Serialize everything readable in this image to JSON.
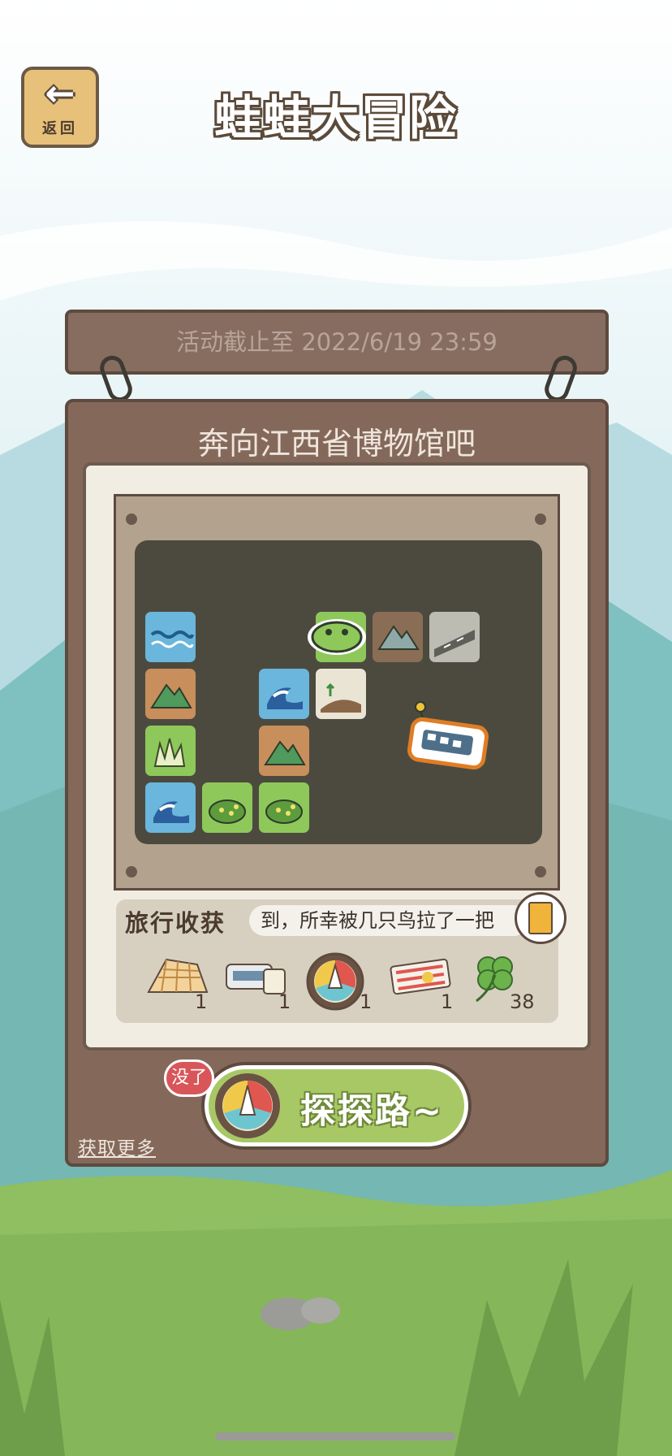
{
  "header": {
    "title": "蛙蛙大冒险",
    "back_label": "返回"
  },
  "event": {
    "deadline_text": "活动截止至 2022/6/19 23:59",
    "destination_title": "奔向江西省博物馆吧"
  },
  "map": {
    "tiles": [
      "water",
      "mountain",
      "grass",
      "wave",
      "bush",
      "bush",
      "wave",
      "mountain",
      "hill",
      "mountain-grey",
      "road"
    ],
    "markers": [
      "frog-icon",
      "train-ticket-marker"
    ]
  },
  "harvest": {
    "label": "旅行收获",
    "ticker": "到，所幸被几只鸟拉了一把",
    "items": [
      {
        "icon": "waffle-icon",
        "count": "1"
      },
      {
        "icon": "ticket-icon",
        "count": "1"
      },
      {
        "icon": "compass-icon",
        "count": "1"
      },
      {
        "icon": "sun-card-icon",
        "count": "1"
      },
      {
        "icon": "clover-icon",
        "count": "38"
      }
    ]
  },
  "actions": {
    "explore_label": "探探路~",
    "out_badge": "没了",
    "more_link": "获取更多"
  },
  "colors": {
    "wood": "#84695b",
    "accent_green": "#a8c866",
    "badge_red": "#d8565a"
  }
}
